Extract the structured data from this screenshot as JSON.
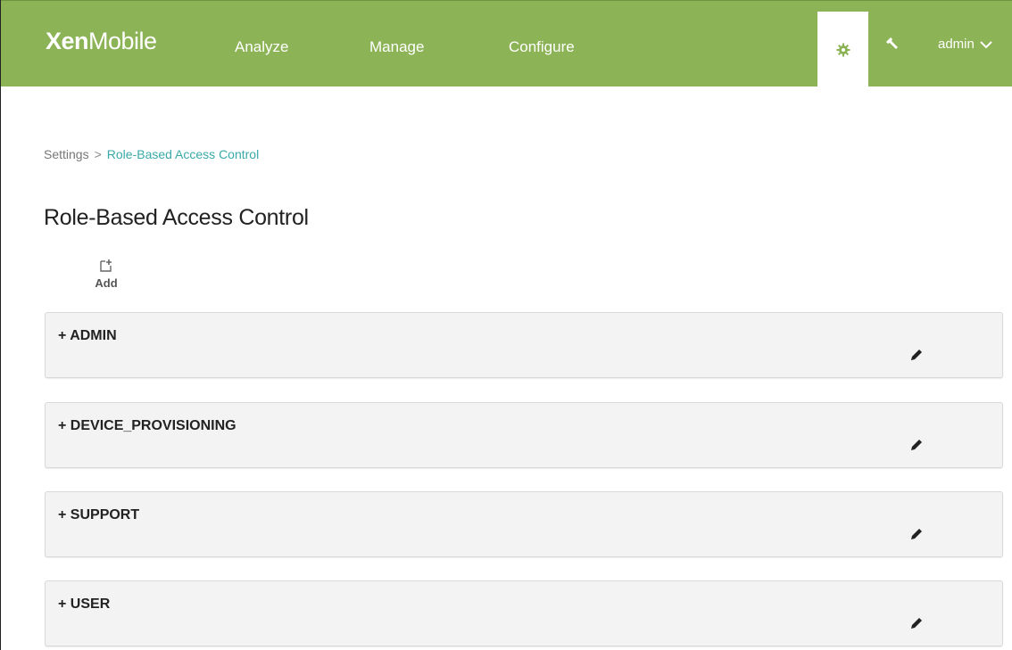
{
  "header": {
    "logo_bold": "Xen",
    "logo_light": "Mobile",
    "nav": [
      {
        "label": "Analyze"
      },
      {
        "label": "Manage"
      },
      {
        "label": "Configure"
      }
    ],
    "user_label": "admin",
    "icons": {
      "settings": "gear-icon",
      "tools": "wrench-icon",
      "user_menu": "chevron-down-icon"
    },
    "colors": {
      "brand": "#8cb355",
      "active_tab": "#ffffff"
    }
  },
  "breadcrumb": {
    "parent": "Settings",
    "separator": ">",
    "current": "Role-Based Access Control"
  },
  "page": {
    "title": "Role-Based Access Control",
    "add_label": "Add"
  },
  "roles": [
    {
      "label": "+ ADMIN"
    },
    {
      "label": "+ DEVICE_PROVISIONING"
    },
    {
      "label": "+ SUPPORT"
    },
    {
      "label": "+ USER"
    }
  ]
}
